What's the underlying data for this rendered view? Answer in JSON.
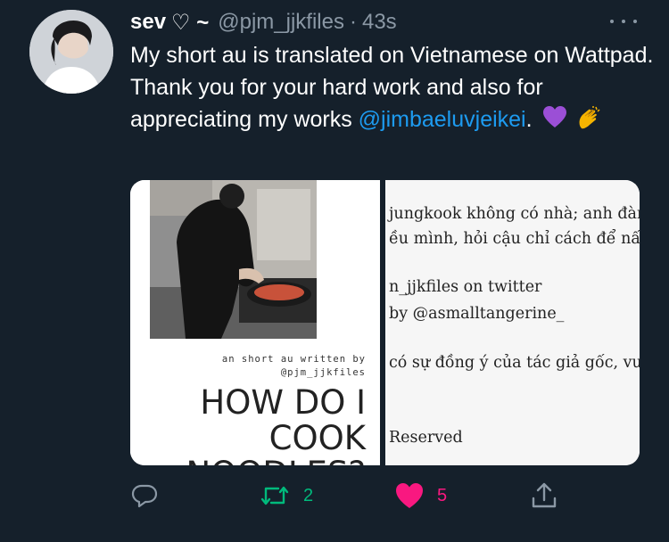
{
  "tweet": {
    "author_name": "sev",
    "author_name_deco": "♡ ~",
    "handle": "@pjm_jjkfiles",
    "separator": "·",
    "time": "43s",
    "text_main": "My short au is translated on Vietnamese on Wattpad. Thank you for your hard work and also for appreciating my works ",
    "mention": "@jimbaeluvjeikei",
    "text_after_mention": ".",
    "emojis": [
      "purple-heart-icon",
      "clapping-hands-icon"
    ]
  },
  "media": {
    "cover": {
      "credit_line1": "an short au written by",
      "credit_line2": "@pjm_jjkfiles",
      "title_line1": "HOW DO I",
      "title_line2": "COOK",
      "title_line3": "NOODLES?"
    },
    "page2": {
      "lines": [
        "jungkook không có nhà; anh đành",
        "ều mình, hỏi cậu chỉ cách để nấu m",
        "n_jjkfiles on twitter",
        "by @asmalltangerine_",
        "có sự đồng ý của tác giả gốc, vui l",
        "Reserved"
      ]
    }
  },
  "actions": {
    "reply_count": "",
    "retweet_count": "2",
    "like_count": "5"
  },
  "colors": {
    "background": "#15202b",
    "accent": "#1d9bf0",
    "retweet": "#00ba7c",
    "like": "#f91880",
    "muted": "#8b98a5"
  }
}
